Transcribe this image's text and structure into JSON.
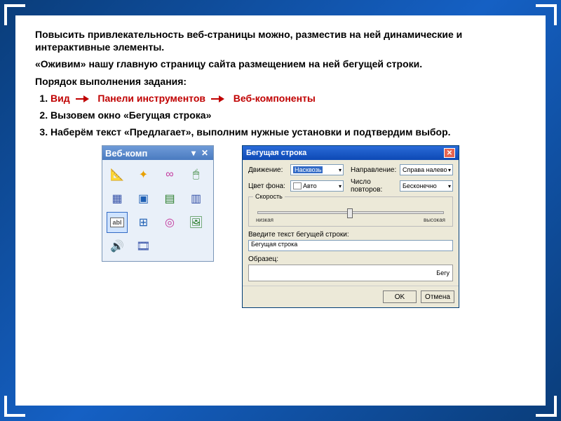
{
  "text": {
    "p1": "Повысить привлекательность веб-страницы можно, разместив на ней динамические и интерактивные элементы.",
    "p2": "«Оживим» нашу главную страницу сайта размещением на ней бегущей строки.",
    "p3": "Порядок выполнения задания:",
    "step1a": "Вид",
    "step1b": "Панели инструментов",
    "step1c": "Веб-компоненты",
    "step2": "Вызовем окно «Бегущая строка»",
    "step3": "Наберём текст «Предлагает», выполним нужные установки и подтвердим выбор."
  },
  "toolbar": {
    "title": "Веб-комп",
    "drop": "▾",
    "close": "✕",
    "icons": [
      {
        "name": "web-wizard-icon",
        "glyph": "📐",
        "color": "#1e5fb4"
      },
      {
        "name": "sparkle-icon",
        "glyph": "✦",
        "color": "#e8a000"
      },
      {
        "name": "link-icon",
        "glyph": "∞",
        "color": "#c43a9e"
      },
      {
        "name": "hover-icon",
        "glyph": "🖱",
        "color": "#2a7d2a"
      },
      {
        "name": "layer-icon",
        "glyph": "▦",
        "color": "#3652a8"
      },
      {
        "name": "frame-icon",
        "glyph": "▣",
        "color": "#1e5fb4"
      },
      {
        "name": "table-icon",
        "glyph": "▤",
        "color": "#2a7d2a"
      },
      {
        "name": "spreadsheet-icon",
        "glyph": "▥",
        "color": "#3652a8"
      },
      {
        "name": "marquee-icon",
        "glyph": "abl",
        "color": "#555",
        "sel": true
      },
      {
        "name": "insert-icon",
        "glyph": "⊞",
        "color": "#1e5fb4"
      },
      {
        "name": "hit-icon",
        "glyph": "◎",
        "color": "#c43a9e"
      },
      {
        "name": "image-icon",
        "glyph": "🖼",
        "color": "#2a7d2a"
      },
      {
        "name": "sound-icon",
        "glyph": "🔊",
        "color": "#e8a000"
      },
      {
        "name": "media-icon",
        "glyph": "🎞",
        "color": "#3652a8"
      }
    ]
  },
  "dialog": {
    "title": "Бегущая строка",
    "close": "✕",
    "labels": {
      "movement": "Движение:",
      "direction": "Направление:",
      "bgcolor": "Цвет фона:",
      "repeat": "Число повторов:",
      "speed_group": "Скорость",
      "slow": "низкая",
      "fast": "высокая",
      "input_label": "Введите текст бегущей строки:",
      "preview_label": "Образец:"
    },
    "values": {
      "movement": "Насквозь",
      "direction": "Справа налево",
      "bgcolor": "Авто",
      "repeat": "Бесконечно",
      "input": "Бегущая строка",
      "preview": "Бегу"
    },
    "buttons": {
      "ok": "OK",
      "cancel": "Отмена"
    }
  }
}
